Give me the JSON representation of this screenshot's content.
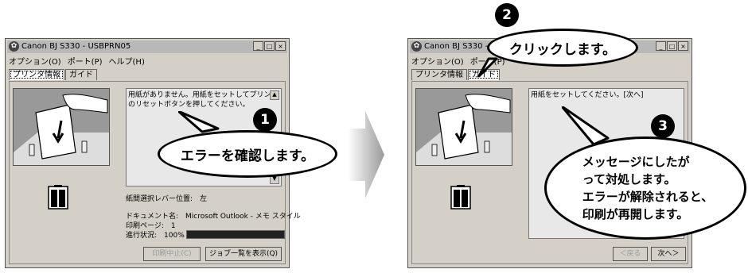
{
  "left": {
    "title": "Canon BJ S330 - USBPRN05",
    "menu": [
      "オプション(O)",
      "ポート(P)",
      "ヘルプ(H)"
    ],
    "tabs": [
      "プリンタ情報",
      "ガイド"
    ],
    "message": "用紙がありません。用紙をセットしてプリンタのリセットボタンを押してください。",
    "lever": "紙間選択レバー位置:　左",
    "document": "ドキュメント名:　Microsoft Outlook - メモ スタイル",
    "page": "印刷ページ:　1",
    "progress_label": "進行状況:　100%",
    "progress": 100,
    "btn_cancel": "印刷中止(C)",
    "btn_joblist": "ジョブ一覧を表示(Q)"
  },
  "right": {
    "title": "Canon BJ S330 - US",
    "menu": [
      "オプション(O)",
      "ポート(P)"
    ],
    "tabs": [
      "プリンタ情報",
      "ガイド"
    ],
    "message": "用紙をセットしてください。[次へ]",
    "btn_back": "＜戻る",
    "btn_next": "次へ＞"
  },
  "callouts": {
    "one": {
      "num": "1",
      "text": "エラーを確認します。"
    },
    "two": {
      "num": "2",
      "text": "クリックします。"
    },
    "three": {
      "num": "3",
      "line1": "メッセージにしたが",
      "line2": "って対処します。",
      "line3": "エラーが解除されると、",
      "line4": "印刷が再開します。"
    }
  },
  "title_buttons": [
    "_",
    "□",
    "×"
  ]
}
